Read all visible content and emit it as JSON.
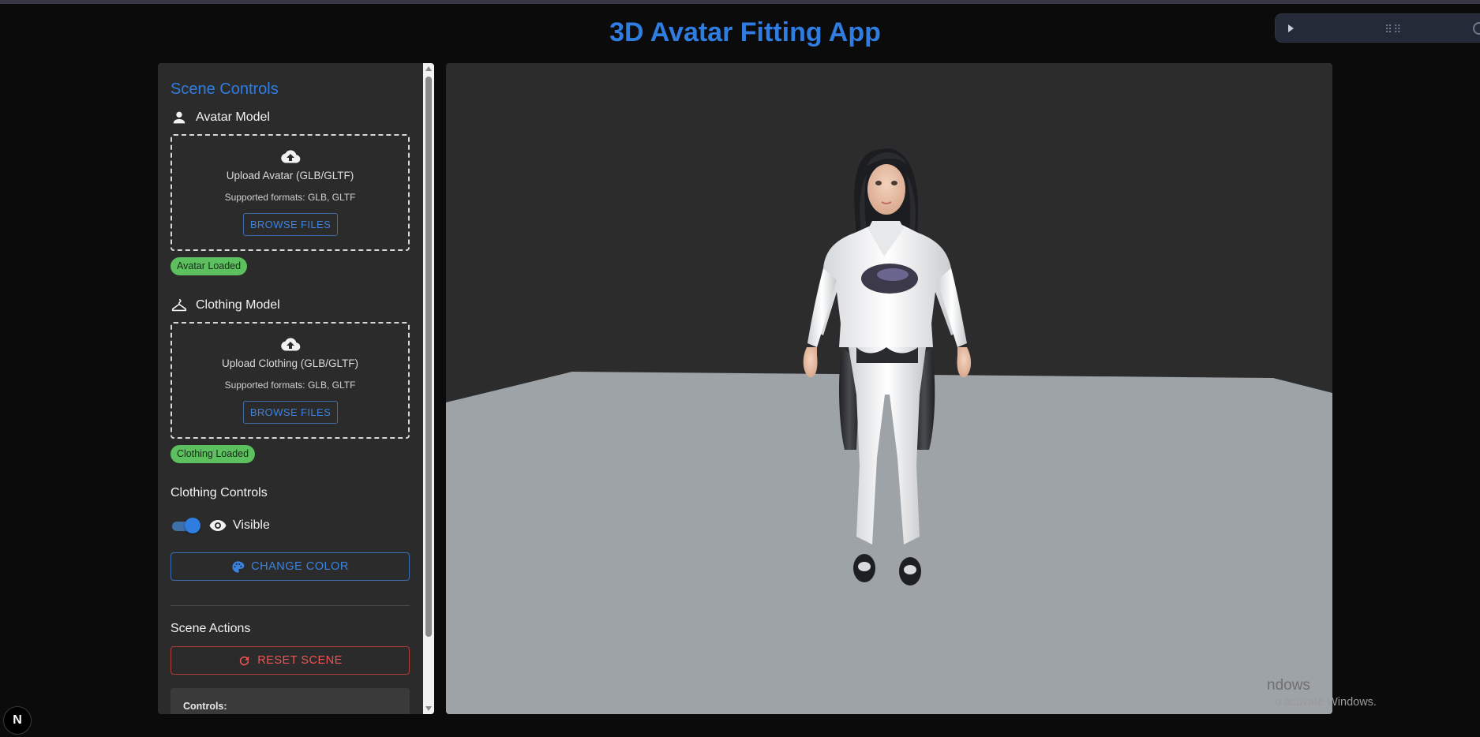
{
  "app": {
    "title": "3D Avatar Fitting App"
  },
  "sidebar": {
    "title": "Scene Controls",
    "avatar": {
      "heading": "Avatar Model",
      "upload_title": "Upload Avatar (GLB/GLTF)",
      "formats": "Supported formats: GLB, GLTF",
      "browse_label": "BROWSE FILES",
      "status": "Avatar Loaded"
    },
    "clothing": {
      "heading": "Clothing Model",
      "upload_title": "Upload Clothing (GLB/GLTF)",
      "formats": "Supported formats: GLB, GLTF",
      "browse_label": "BROWSE FILES",
      "status": "Clothing Loaded"
    },
    "clothing_controls": {
      "heading": "Clothing Controls",
      "visible_label": "Visible",
      "visible": true,
      "change_color_label": "CHANGE COLOR"
    },
    "scene_actions": {
      "heading": "Scene Actions",
      "reset_label": "RESET SCENE"
    },
    "controls_box": {
      "title": "Controls:"
    }
  },
  "watermark": {
    "line1": "ndows",
    "line2": "o activate Windows."
  },
  "badge": {
    "label": "N"
  },
  "colors": {
    "accent": "#2f7de0",
    "success": "#5cc05f",
    "danger": "#f05454",
    "floor": "#9ea3a8",
    "viewport_bg": "#2c2c2c"
  },
  "icons": {
    "avatar_heading": "person-icon",
    "clothing_heading": "hanger-icon",
    "upload": "cloud-upload-icon",
    "visibility": "eye-icon",
    "change_color": "palette-icon",
    "reset": "refresh-icon"
  }
}
